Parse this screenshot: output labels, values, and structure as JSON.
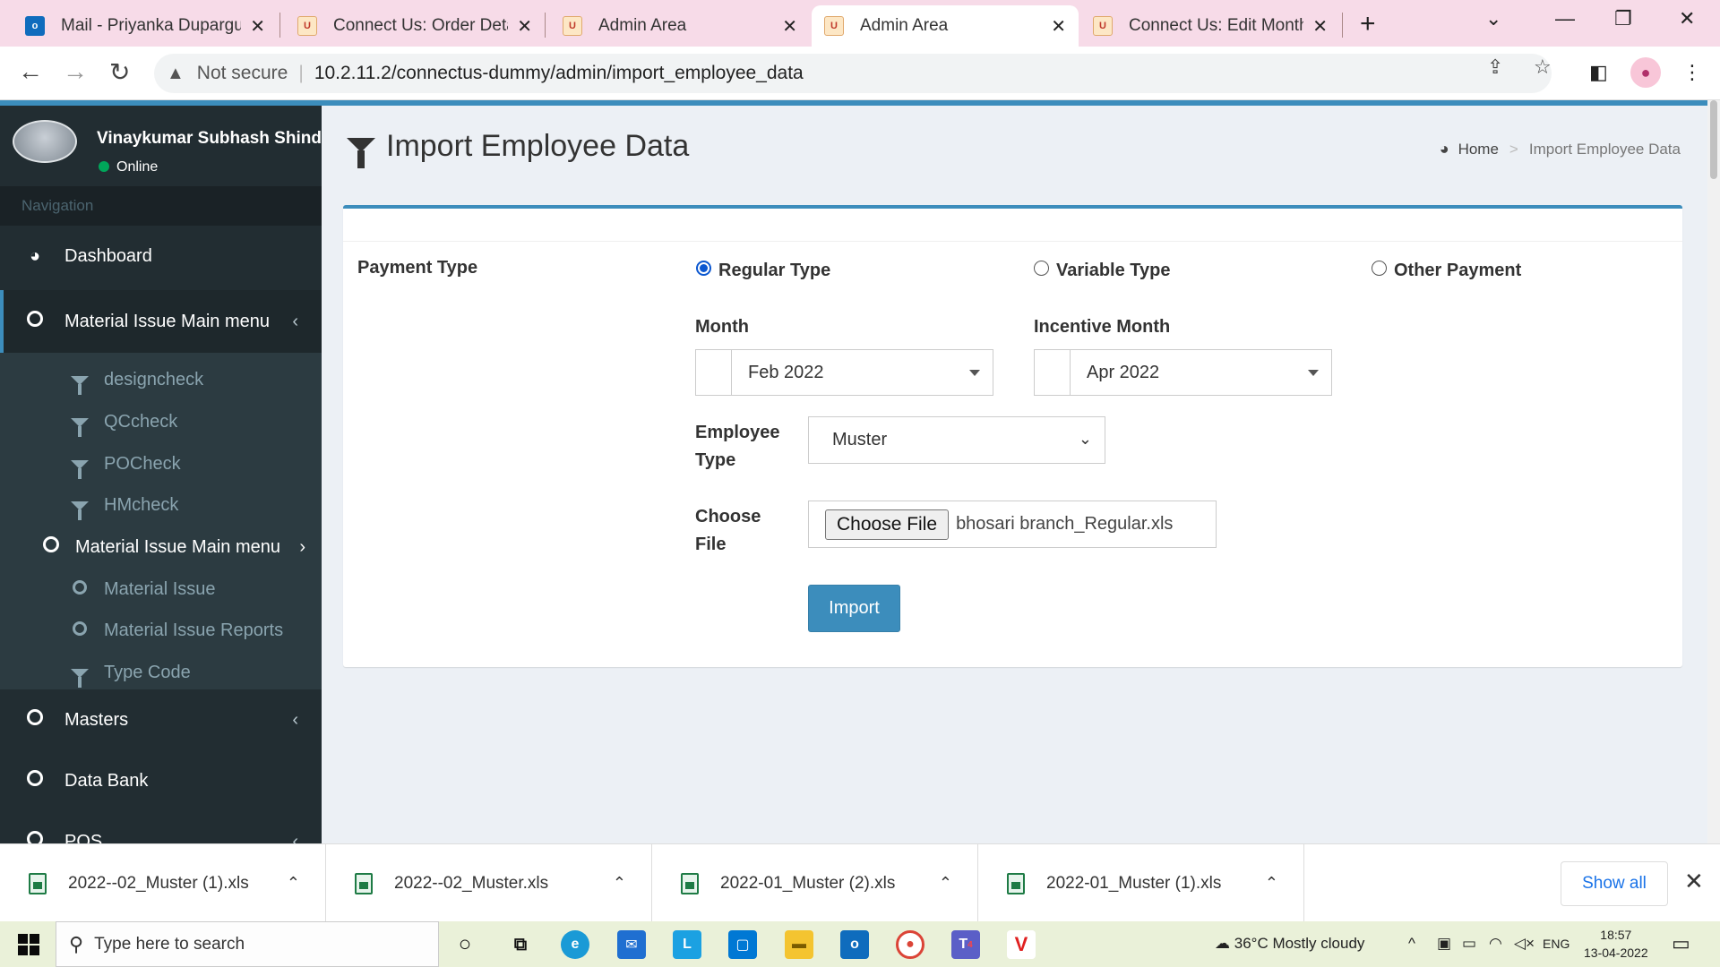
{
  "browser": {
    "tabs": [
      {
        "title": "Mail - Priyanka Dupargude",
        "favicon": "outlook-mail-icon",
        "active": false
      },
      {
        "title": "Connect Us: Order Details",
        "favicon": "site-favicon",
        "active": false
      },
      {
        "title": "Admin Area",
        "favicon": "site-favicon",
        "active": false
      },
      {
        "title": "Admin Area",
        "favicon": "site-favicon",
        "active": true
      },
      {
        "title": "Connect Us: Edit Monthly",
        "favicon": "site-favicon",
        "active": false
      }
    ],
    "security_label": "Not secure",
    "url": "10.2.11.2/connectus-dummy/admin/import_employee_data",
    "colors": {
      "tab_strip": "#f7dbe8",
      "active_tab": "#ffffff"
    }
  },
  "sidebar": {
    "user_name": "Vinaykumar Subhash Shinde",
    "user_status": "Online",
    "nav_header": "Navigation",
    "items": [
      {
        "label": "Dashboard",
        "icon": "dashboard-icon"
      },
      {
        "label": "Material Issue Main menu",
        "icon": "circle-icon",
        "expanded": true
      },
      {
        "label": "Masters",
        "icon": "circle-icon"
      },
      {
        "label": "Data Bank",
        "icon": "circle-icon"
      },
      {
        "label": "POS",
        "icon": "circle-icon"
      }
    ],
    "subitems": [
      {
        "label": "designcheck",
        "icon": "filter-icon"
      },
      {
        "label": "QCcheck",
        "icon": "filter-icon"
      },
      {
        "label": "POCheck",
        "icon": "filter-icon"
      },
      {
        "label": "HMcheck",
        "icon": "filter-icon"
      },
      {
        "label": "Material Issue Main menu",
        "icon": "circle-icon"
      },
      {
        "label": "Material Issue",
        "icon": "circle-icon"
      },
      {
        "label": "Material Issue Reports",
        "icon": "circle-icon"
      },
      {
        "label": "Type Code",
        "icon": "filter-icon"
      }
    ],
    "colors": {
      "background": "#222d32",
      "submenu": "#2c3b41",
      "accent": "#3c8dbc"
    }
  },
  "content": {
    "title": "Import Employee Data",
    "breadcrumb": {
      "home": "Home",
      "current": "Import Employee Data"
    }
  },
  "form": {
    "payment_type_label": "Payment Type",
    "payment_options": [
      {
        "label": "Regular Type",
        "checked": true
      },
      {
        "label": "Variable Type",
        "checked": false
      },
      {
        "label": "Other Payment",
        "checked": false
      }
    ],
    "month_label": "Month",
    "month_value": "Feb 2022",
    "incentive_month_label": "Incentive Month",
    "incentive_month_value": "Apr 2022",
    "employee_type_label_line1": "Employee",
    "employee_type_label_line2": "Type",
    "employee_type_value": "Muster",
    "choose_file_label_line1": "Choose",
    "choose_file_label_line2": "File",
    "choose_file_button": "Choose File",
    "file_name": "bhosari branch_Regular.xls",
    "import_button": "Import",
    "colors": {
      "primary_button": "#3c8dbc",
      "radio_checked": "#0b57d0"
    }
  },
  "downloads": {
    "items": [
      "2022--02_Muster (1).xls",
      "2022--02_Muster.xls",
      "2022-01_Muster (2).xls",
      "2022-01_Muster (1).xls"
    ],
    "show_all": "Show all"
  },
  "taskbar": {
    "search_placeholder": "Type here to search",
    "weather": "36°C  Mostly cloudy",
    "language": "ENG",
    "time": "18:57",
    "date": "13-04-2022",
    "teams_badge": "4"
  }
}
